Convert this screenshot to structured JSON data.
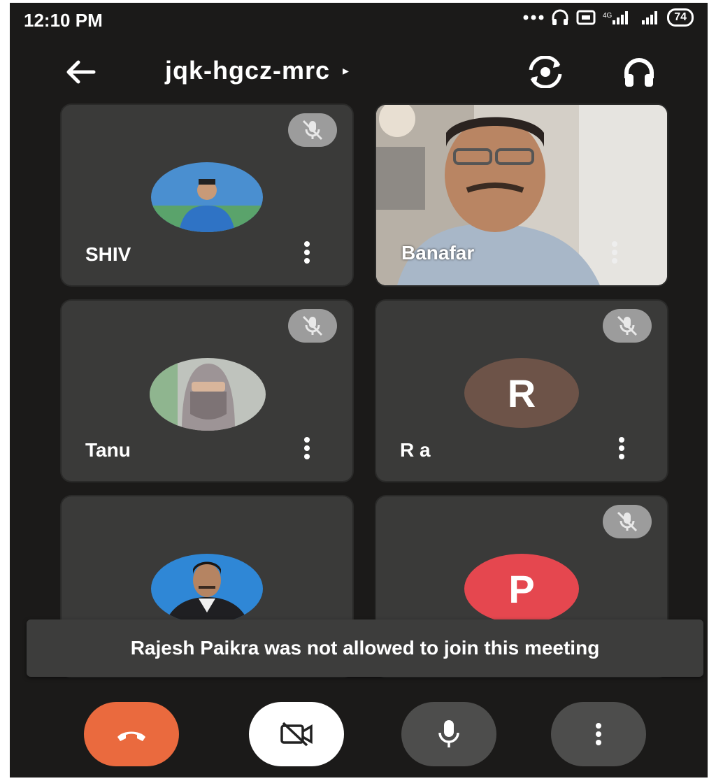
{
  "status_bar": {
    "time": "12:10 PM",
    "battery": "74",
    "icons": [
      "more-dots-icon",
      "headphones-icon",
      "data-saver-icon",
      "signal-icon",
      "signal-icon",
      "battery-icon"
    ]
  },
  "header": {
    "meeting_code": "jqk-hgcz-mrc",
    "caret": "▸",
    "icons": [
      "back-arrow-icon",
      "switch-camera-icon",
      "headphones-icon"
    ]
  },
  "participants": [
    {
      "name": "SHIV",
      "avatar": "photo",
      "muted": true
    },
    {
      "name": "Banafar",
      "avatar": "video",
      "muted": false
    },
    {
      "name": "Tanu",
      "avatar": "photo",
      "muted": true
    },
    {
      "name": "R a",
      "avatar": "letter",
      "initial": "R",
      "color": "#6d5348",
      "muted": true
    },
    {
      "name": "",
      "avatar": "photo",
      "muted": false
    },
    {
      "name": "",
      "avatar": "letter",
      "initial": "P",
      "color": "#e5474f",
      "muted": true
    }
  ],
  "toast": {
    "message": "Rajesh Paikra was not allowed to join this meeting"
  },
  "controls": {
    "icons": [
      "end-call-icon",
      "camera-off-icon",
      "microphone-icon",
      "more-vert-icon"
    ],
    "colors": {
      "end_call": "#ea6a3e",
      "camera": "#ffffff",
      "neutral": "#4d4d4c"
    }
  }
}
